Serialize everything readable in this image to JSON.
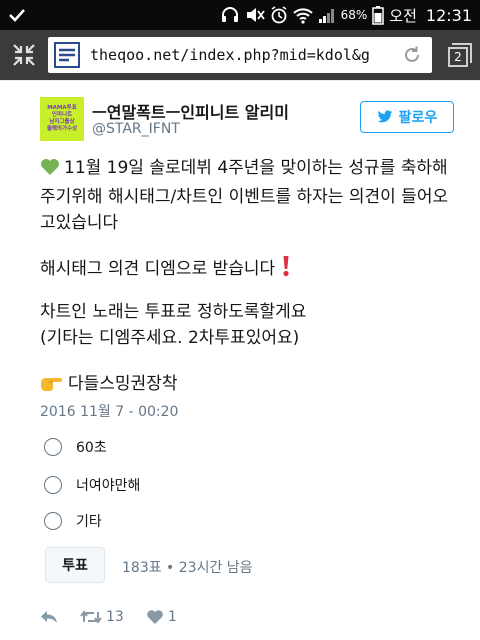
{
  "status_bar": {
    "battery": "68%",
    "am_pm": "오전",
    "time": "12:31"
  },
  "browser": {
    "url": "theqoo.net/index.php?mid=kdol&g",
    "tab_count": "2"
  },
  "tweet": {
    "display_name": "ㅡ연말폭트ㅡ인피니트 알리미",
    "username": "@STAR_IFNT",
    "avatar_text": [
      "MAMA투표",
      "인피니트",
      "남자그룹상",
      "올해의가수상"
    ],
    "follow_label": "팔로우",
    "paragraph1": "11월 19일 솔로데뷔 4주년을 맞이하는 성규를 축하해주기위해 해시태그/차트인 이벤트를 하자는 의견이 들어오고있습니다",
    "paragraph2": "해시태그 의견 디엠으로 받습니다",
    "paragraph3_line1": "차트인 노래는 투표로 정하도록할게요",
    "paragraph3_line2": "(기타는 디엠주세요. 2차투표있어요)",
    "paragraph4": "다들스밍권장착",
    "timestamp": "2016 11월 7 - 00:20",
    "poll_options": [
      "60초",
      "너여야만해",
      "기타"
    ],
    "vote_label": "투표",
    "poll_meta": "183표 • 23시간 남음",
    "retweet_count": "13",
    "like_count": "1"
  },
  "colors": {
    "accent": "#1da1f2",
    "muted": "#657786",
    "avatar_bg": "#c8ef2a",
    "heart_emoji": "#77b255",
    "exclamation": "#dd2e44"
  }
}
